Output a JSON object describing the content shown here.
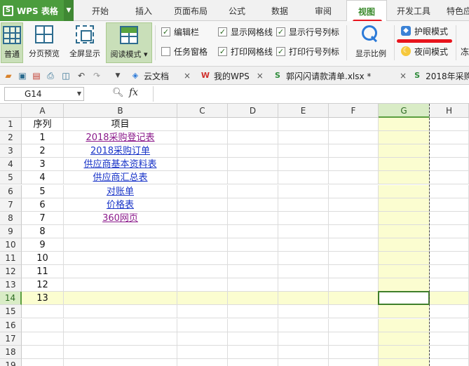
{
  "app": {
    "name": "WPS 表格",
    "logo": "S"
  },
  "menu_tabs": [
    "开始",
    "插入",
    "页面布局",
    "公式",
    "数据",
    "审阅",
    "视图",
    "开发工具",
    "特色应"
  ],
  "active_tab": "视图",
  "ribbon": {
    "normal": "普通",
    "page_preview": "分页预览",
    "fullscreen": "全屏显示",
    "read_mode": "阅读模式",
    "chk_edit_bar": "编辑栏",
    "chk_task_pane": "任务窗格",
    "chk_show_grid": "显示网格线",
    "chk_print_grid": "打印网格线",
    "chk_show_headers": "显示行号列标",
    "chk_print_headers": "打印行号列标",
    "zoom": "显示比例",
    "eye_mode": "护眼模式",
    "night_mode": "夜间模式",
    "cut_label": "冻"
  },
  "doc_tabs": {
    "cloud": "云文档",
    "mywps": "我的WPS",
    "file": "郭闪闪请款清单.xlsx *",
    "next": "2018年采购"
  },
  "formula_bar": {
    "cell_ref": "G14",
    "fx": "fx",
    "value": ""
  },
  "columns": [
    "A",
    "B",
    "C",
    "D",
    "E",
    "F",
    "G",
    "H"
  ],
  "rows": [
    "1",
    "2",
    "3",
    "4",
    "5",
    "6",
    "7",
    "8",
    "9",
    "10",
    "11",
    "12",
    "13",
    "14",
    "15",
    "16",
    "17",
    "18",
    "19"
  ],
  "table": {
    "header": {
      "seq": "序列",
      "item": "项目"
    },
    "items": [
      {
        "seq": "1",
        "item": "2018采购登记表"
      },
      {
        "seq": "2",
        "item": "2018采购订单"
      },
      {
        "seq": "3",
        "item": "供应商基本资料表"
      },
      {
        "seq": "4",
        "item": "供应商汇总表"
      },
      {
        "seq": "5",
        "item": "对账单"
      },
      {
        "seq": "6",
        "item": "价格表"
      },
      {
        "seq": "7",
        "item": "360网页"
      },
      {
        "seq": "8",
        "item": ""
      },
      {
        "seq": "9",
        "item": ""
      },
      {
        "seq": "10",
        "item": ""
      },
      {
        "seq": "11",
        "item": ""
      },
      {
        "seq": "12",
        "item": ""
      },
      {
        "seq": "13",
        "item": ""
      }
    ]
  },
  "colors": {
    "accent": "#4b9c3d",
    "eye_highlight": "#fbfdd0",
    "link": "#1a35c8",
    "visited_link": "#8b1a8b",
    "annotation": "#e8141d"
  }
}
